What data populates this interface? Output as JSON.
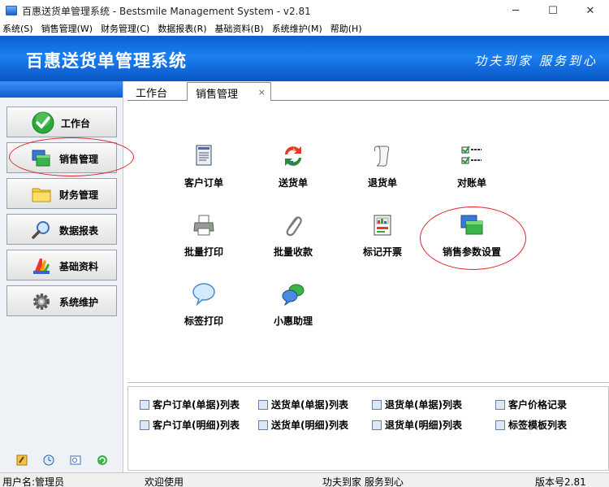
{
  "window": {
    "title": "百惠送货单管理系统 - Bestsmile Management System - v2.81",
    "minimize": "─",
    "maximize": "☐",
    "close": "✕"
  },
  "menu": [
    "系统(S)",
    "销售管理(W)",
    "财务管理(C)",
    "数据报表(R)",
    "基础资料(B)",
    "系统维护(M)",
    "帮助(H)"
  ],
  "banner": {
    "app_name": "百惠送货单管理系统",
    "slogan": "功夫到家 服务到心"
  },
  "sidebar": {
    "items": [
      {
        "label": "工作台",
        "icon": "check-icon"
      },
      {
        "label": "销售管理",
        "icon": "windows-icon"
      },
      {
        "label": "财务管理",
        "icon": "folder-icon"
      },
      {
        "label": "数据报表",
        "icon": "magnifier-icon"
      },
      {
        "label": "基础资料",
        "icon": "palette-icon"
      },
      {
        "label": "系统维护",
        "icon": "gear-icon"
      }
    ]
  },
  "tabs": {
    "items": [
      {
        "label": "工作台"
      },
      {
        "label": "销售管理"
      }
    ],
    "active": "销售管理",
    "close_glyph": "×"
  },
  "grid": [
    {
      "label": "客户订单",
      "icon": "document-icon"
    },
    {
      "label": "送货单",
      "icon": "refresh-icon"
    },
    {
      "label": "退货单",
      "icon": "scroll-icon"
    },
    {
      "label": "对账单",
      "icon": "checklist-icon"
    },
    {
      "label": "批量打印",
      "icon": "printer-icon"
    },
    {
      "label": "批量收款",
      "icon": "paperclip-icon"
    },
    {
      "label": "标记开票",
      "icon": "chart-doc-icon"
    },
    {
      "label": "销售参数设置",
      "icon": "windows-icon"
    },
    {
      "label": "标签打印",
      "icon": "speech-bubble-icon"
    },
    {
      "label": "小惠助理",
      "icon": "chat-bubbles-icon"
    }
  ],
  "links": {
    "col1": [
      "客户订单(单据)列表",
      "客户订单(明细)列表"
    ],
    "col2": [
      "送货单(单据)列表",
      "送货单(明细)列表"
    ],
    "col3": [
      "退货单(单据)列表",
      "退货单(明细)列表"
    ],
    "col4": [
      "客户价格记录",
      "标签模板列表"
    ]
  },
  "status": {
    "user": "用户名:管理员",
    "welcome": "欢迎使用",
    "slogan": "功夫到家 服务到心",
    "version": "版本号2.81"
  },
  "colors": {
    "banner": "#1a7ff0",
    "annotation": "#e0242a"
  }
}
